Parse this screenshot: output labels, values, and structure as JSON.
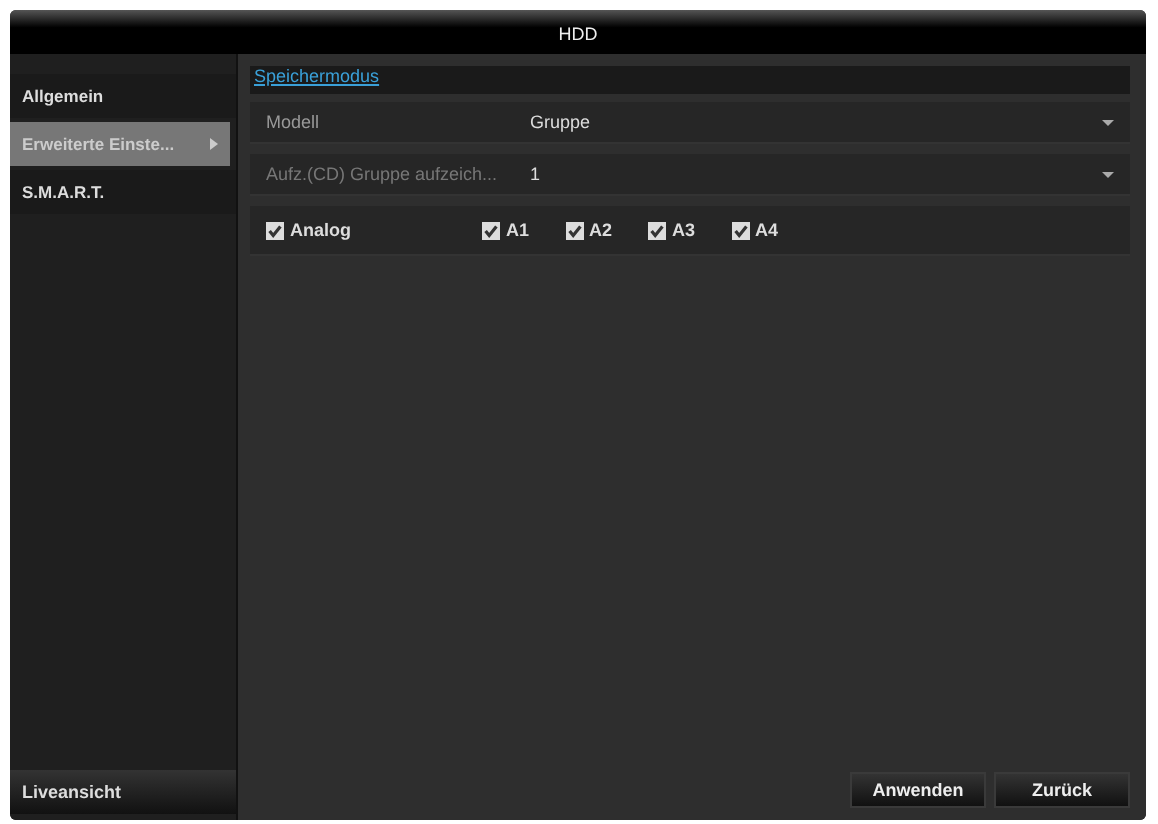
{
  "window": {
    "title": "HDD"
  },
  "sidebar": {
    "items": [
      {
        "label": "Allgemein",
        "selected": false,
        "expanded": false
      },
      {
        "label": "Erweiterte Einste...",
        "selected": true,
        "expanded": true
      },
      {
        "label": "S.M.A.R.T.",
        "selected": false,
        "expanded": false
      }
    ],
    "footer": "Liveansicht"
  },
  "tabs": [
    {
      "label": "Speichermodus",
      "selected": true
    }
  ],
  "fields": [
    {
      "label": "Modell",
      "value": "Gruppe",
      "disabled": false
    },
    {
      "label": "Aufz.(CD) Gruppe aufzeich...",
      "value": "1",
      "disabled": true
    }
  ],
  "checkboxes": [
    {
      "label": "Analog",
      "checked": true
    },
    {
      "label": "A1",
      "checked": true
    },
    {
      "label": "A2",
      "checked": true
    },
    {
      "label": "A3",
      "checked": true
    },
    {
      "label": "A4",
      "checked": true
    }
  ],
  "buttons": [
    "Anwenden",
    "Zurück"
  ]
}
